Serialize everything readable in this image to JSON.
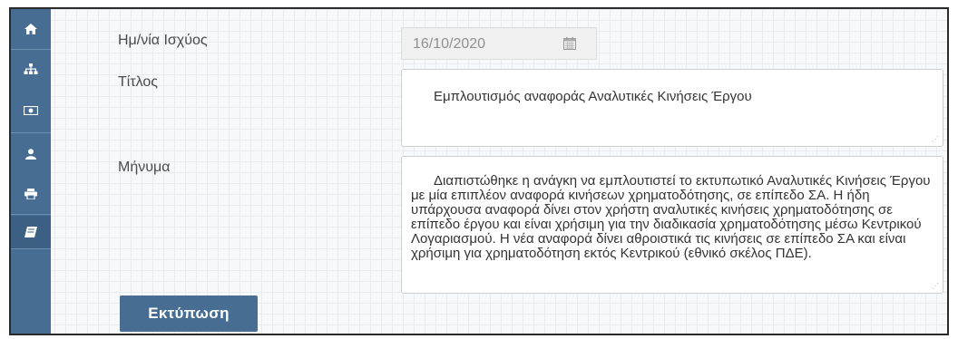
{
  "sidebar": {
    "items": [
      {
        "icon": "home-icon"
      },
      {
        "icon": "sitemap-icon"
      },
      {
        "icon": "money-icon"
      },
      {
        "icon": "user-icon"
      },
      {
        "icon": "print-icon"
      },
      {
        "icon": "book-icon",
        "active": true
      }
    ]
  },
  "form": {
    "date_label": "Ημ/νία Ισχύος",
    "date_value": "16/10/2020",
    "title_label": "Τίτλος",
    "title_value": "Εμπλουτισμός αναφοράς Αναλυτικές Κινήσεις Έργου",
    "message_label": "Μήνυμα",
    "message_value": "Διαπιστώθηκε η ανάγκη να εμπλουτιστεί το εκτυπωτικό Αναλυτικές Κινήσεις Έργου με μία επιπλέον αναφορά κινήσεων χρηματοδότησης, σε επίπεδο ΣΑ. Η ήδη υπάρχουσα αναφορά δίνει στον χρήστη αναλυτικές κινήσεις χρηματοδότησης σε επίπεδο έργου και είναι χρήσιμη για την διαδικασία χρηματοδότησης μέσω Κεντρικού Λογαριασμού. Η νέα αναφορά δίνει αθροιστικά τις κινήσεις σε επίπεδο ΣΑ και είναι χρήσιμη για χρηματοδότηση εκτός Κεντρικού (εθνικό σκέλος ΠΔΕ).",
    "print_button": "Εκτύπωση"
  },
  "colors": {
    "sidebar": "#476e92",
    "button": "#476e92"
  }
}
